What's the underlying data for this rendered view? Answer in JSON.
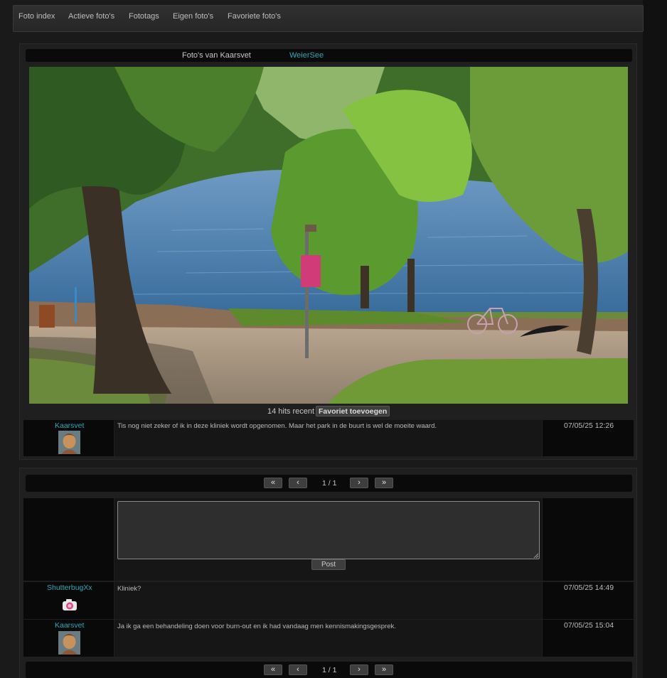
{
  "nav": {
    "items": [
      {
        "label": "Foto index"
      },
      {
        "label": "Actieve foto's"
      },
      {
        "label": "Fototags"
      },
      {
        "label": "Eigen foto's"
      },
      {
        "label": "Favoriete foto's"
      }
    ]
  },
  "photo_header": {
    "label": "Foto's van Kaarsvet",
    "link": "WeierSee"
  },
  "photo_stats": {
    "hits": "14 hits recent",
    "favorite_button": "Favoriet toevoegen"
  },
  "owner_post": {
    "user": "Kaarsvet",
    "message": "Tis nog niet zeker of ik in deze kliniek wordt opgenomen. Maar het park in de buurt is wel de moeite waard.",
    "timestamp": "07/05/25 12:26"
  },
  "pager_top": {
    "first": "«",
    "prev": "‹",
    "info": "1 / 1",
    "next": "›",
    "last": "»"
  },
  "comment_form": {
    "textarea_value": "",
    "post_button": "Post"
  },
  "comments": [
    {
      "user": "ShutterbugXx",
      "message": "Kliniek?",
      "timestamp": "07/05/25 14:49",
      "avatar_icon": "camera-icon"
    },
    {
      "user": "Kaarsvet",
      "message": "Ja ik ga een behandeling doen voor burn-out en ik had vandaag men kennismakingsgesprek.",
      "timestamp": "07/05/25 15:04",
      "avatar_icon": "portrait"
    }
  ],
  "pager_bottom": {
    "first": "«",
    "prev": "‹",
    "info": "1 / 1",
    "next": "›",
    "last": "»"
  }
}
